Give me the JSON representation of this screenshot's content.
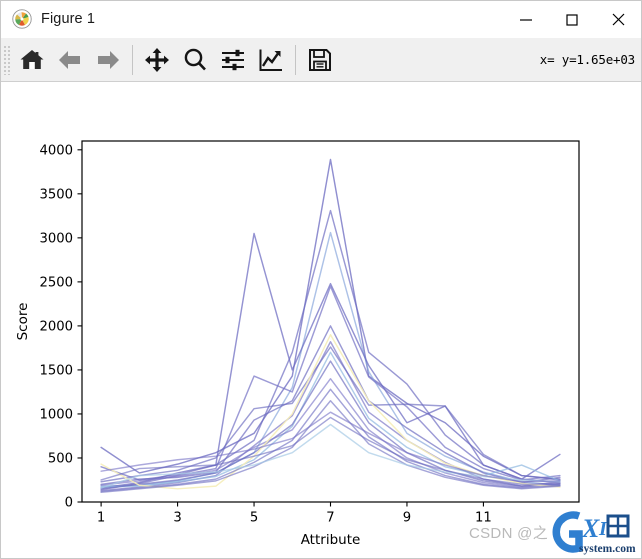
{
  "window": {
    "title": "Figure 1",
    "icon": "matplotlib-pinwheel-icon",
    "controls": {
      "minimize_label": "Minimize",
      "maximize_label": "Maximize",
      "close_label": "Close"
    }
  },
  "toolbar": {
    "buttons": [
      {
        "name": "home-icon",
        "tooltip": "Reset original view"
      },
      {
        "name": "back-arrow-icon",
        "tooltip": "Back to previous view"
      },
      {
        "name": "forward-arrow-icon",
        "tooltip": "Forward to next view"
      },
      {
        "name": "pan-move-icon",
        "tooltip": "Pan axes with left mouse, zoom with right"
      },
      {
        "name": "zoom-magnifier-icon",
        "tooltip": "Zoom to rectangle"
      },
      {
        "name": "configure-subplots-icon",
        "tooltip": "Configure subplots"
      },
      {
        "name": "edit-axis-curve-icon",
        "tooltip": "Edit axis, curve and image parameters"
      },
      {
        "name": "save-floppy-icon",
        "tooltip": "Save the figure"
      }
    ],
    "coordinate_readout": "x= y=1.65e+03"
  },
  "watermarks": {
    "csdn": "CSDN @之",
    "logo_main": "GXI网",
    "logo_sub": "system.com"
  },
  "chart_data": {
    "type": "line",
    "title": "",
    "xlabel": "Attribute",
    "ylabel": "Score",
    "xlim": [
      0.5,
      13.5
    ],
    "ylim": [
      0,
      4100
    ],
    "xticks": [
      1,
      3,
      5,
      7,
      9,
      11
    ],
    "yticks": [
      0,
      500,
      1000,
      1500,
      2000,
      2500,
      3000,
      3500,
      4000
    ],
    "grid": false,
    "legend": "none",
    "colormap": "cool-purple-blue",
    "x": [
      1,
      2,
      3,
      4,
      5,
      6,
      7,
      8,
      9,
      10,
      11,
      12,
      13
    ],
    "series": [
      {
        "name": "line-01",
        "color": "#6b6ac0",
        "alpha": 0.75,
        "values": [
          620,
          330,
          430,
          560,
          780,
          1430,
          3890,
          1430,
          1120,
          900,
          520,
          300,
          260
        ]
      },
      {
        "name": "line-02",
        "color": "#6f6ec2",
        "alpha": 0.7,
        "values": [
          400,
          250,
          310,
          420,
          700,
          1700,
          3310,
          1700,
          1340,
          760,
          420,
          260,
          220
        ]
      },
      {
        "name": "line-03",
        "color": "#8aa8dd",
        "alpha": 0.7,
        "values": [
          180,
          190,
          240,
          330,
          560,
          1300,
          3060,
          1480,
          780,
          520,
          340,
          230,
          190
        ]
      },
      {
        "name": "line-04",
        "color": "#6b6ac0",
        "alpha": 0.72,
        "values": [
          160,
          220,
          330,
          420,
          3050,
          1500,
          2480,
          1550,
          900,
          1090,
          420,
          260,
          540
        ]
      },
      {
        "name": "line-05",
        "color": "#7470c4",
        "alpha": 0.7,
        "values": [
          140,
          210,
          300,
          380,
          1430,
          1250,
          2450,
          1420,
          1080,
          620,
          380,
          250,
          300
        ]
      },
      {
        "name": "line-06",
        "color": "#6b6ac0",
        "alpha": 0.68,
        "values": [
          200,
          260,
          280,
          340,
          930,
          1150,
          2000,
          1150,
          840,
          560,
          330,
          220,
          280
        ]
      },
      {
        "name": "line-07",
        "color": "#7a74c6",
        "alpha": 0.68,
        "values": [
          130,
          170,
          220,
          300,
          640,
          980,
          1820,
          1020,
          700,
          450,
          260,
          180,
          230
        ]
      },
      {
        "name": "line-08",
        "color": "#6b6ac0",
        "alpha": 0.66,
        "values": [
          230,
          300,
          360,
          500,
          1060,
          1120,
          1760,
          1100,
          1110,
          1090,
          540,
          300,
          250
        ]
      },
      {
        "name": "line-09",
        "color": "#8fb8e0",
        "alpha": 0.7,
        "values": [
          170,
          180,
          230,
          290,
          480,
          860,
          1700,
          950,
          620,
          400,
          300,
          420,
          240
        ]
      },
      {
        "name": "line-10",
        "color": "#6b6ac0",
        "alpha": 0.66,
        "values": [
          150,
          200,
          250,
          330,
          560,
          880,
          1600,
          900,
          560,
          360,
          240,
          180,
          200
        ]
      },
      {
        "name": "line-11",
        "color": "#7b77c8",
        "alpha": 0.64,
        "values": [
          190,
          240,
          290,
          360,
          620,
          820,
          1400,
          820,
          500,
          330,
          220,
          170,
          210
        ]
      },
      {
        "name": "line-12",
        "color": "#f5edb8",
        "alpha": 0.9,
        "values": [
          430,
          190,
          150,
          180,
          520,
          1000,
          1900,
          1150,
          700,
          440,
          300,
          210,
          170
        ]
      },
      {
        "name": "line-13",
        "color": "#6b6ac0",
        "alpha": 0.62,
        "values": [
          120,
          160,
          200,
          260,
          450,
          700,
          1280,
          740,
          460,
          300,
          200,
          160,
          190
        ]
      },
      {
        "name": "line-14",
        "color": "#6b6ac0",
        "alpha": 0.6,
        "values": [
          110,
          150,
          190,
          240,
          400,
          620,
          1150,
          660,
          420,
          280,
          190,
          150,
          180
        ]
      },
      {
        "name": "line-15",
        "color": "#a6cbe6",
        "alpha": 0.7,
        "values": [
          160,
          300,
          320,
          340,
          420,
          560,
          880,
          560,
          420,
          340,
          290,
          250,
          230
        ]
      },
      {
        "name": "line-16",
        "color": "#6b6ac0",
        "alpha": 0.6,
        "values": [
          250,
          380,
          400,
          420,
          520,
          640,
          960,
          700,
          480,
          360,
          260,
          200,
          210
        ]
      },
      {
        "name": "line-17",
        "color": "#7470c4",
        "alpha": 0.6,
        "values": [
          350,
          420,
          480,
          520,
          600,
          720,
          1020,
          780,
          560,
          420,
          300,
          230,
          240
        ]
      }
    ]
  }
}
